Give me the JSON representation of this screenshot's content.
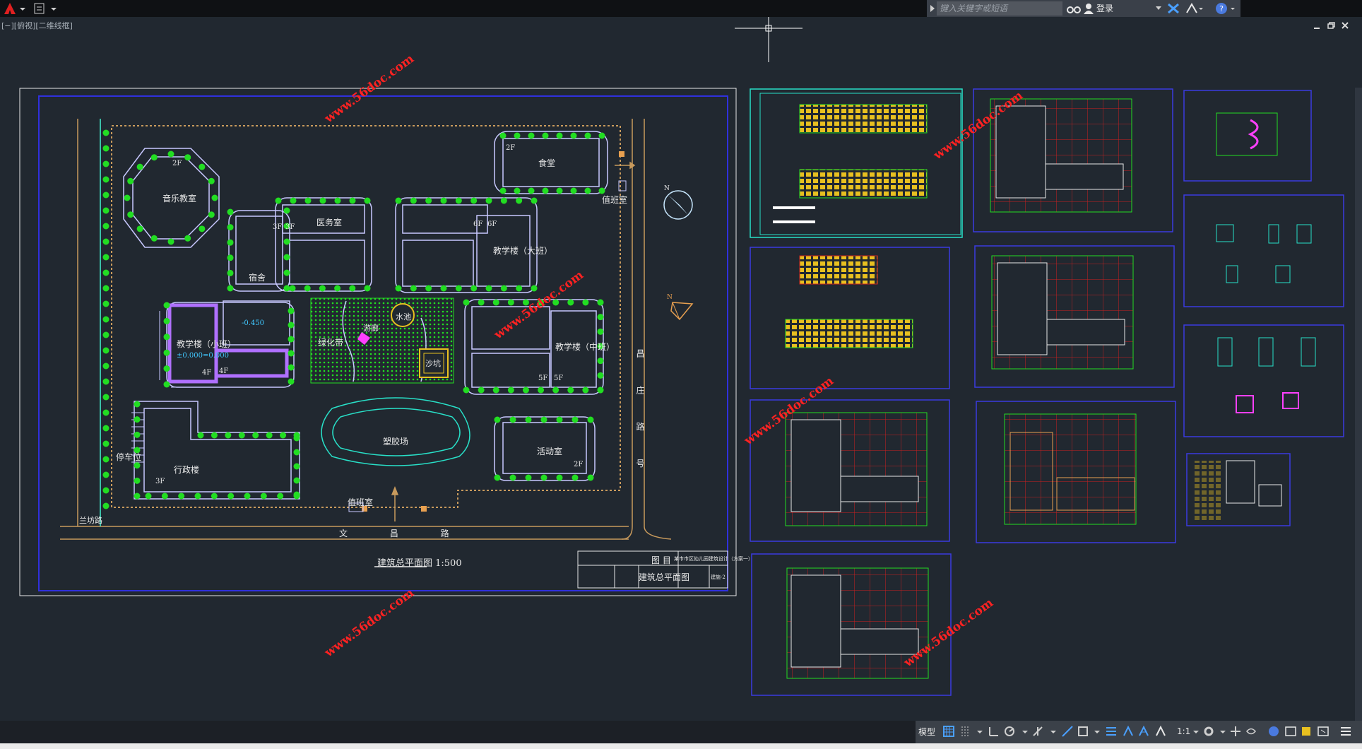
{
  "titlebar": {
    "search_placeholder": "键入关键字或短语",
    "login": "登录"
  },
  "viewport_label": "[−][俯视][二维线框]",
  "site_plan": {
    "buildings": {
      "music": "音乐教室",
      "music_floors": "2F",
      "dormitory": "宿舍",
      "dorm_floors": "3F",
      "clinic": "医务室",
      "clinic_floors": "3F",
      "canteen": "食堂",
      "canteen_floors": "2F",
      "teach_large": "教学楼（大班）",
      "teach_large_floors_a": "6F",
      "teach_large_floors_b": "6F",
      "teach_small": "教学楼（小班）",
      "teach_small_floors_a": "4F",
      "teach_small_floors_b": "4F",
      "teach_mid": "教学楼（中班）",
      "teach_mid_floors_a": "5F",
      "teach_mid_floors_b": "5F",
      "admin": "行政楼",
      "admin_floors": "3F",
      "gym": "活动室",
      "gym_floors": "2F"
    },
    "landscape": {
      "garden": "绿化带",
      "corridor": "游廊",
      "pond": "水池",
      "sandpit": "沙坑",
      "track": "塑胶场"
    },
    "elevations": {
      "level_a": "-0.450",
      "level_b": "±0.000=0.000"
    },
    "labels": {
      "guard_top": "值班室",
      "guard_bottom": "值班室",
      "parking": "停车位",
      "north": "N",
      "north_small": "N",
      "road_bottom": "文 昌 路",
      "road_right": "昌 庄 路 号",
      "road_left": "兰坊路"
    },
    "plan_title": "建筑总平面图 1:500",
    "titleblock": {
      "header": "图 目",
      "project": "某市市区幼儿园建筑设计（方案一）",
      "drawing_name": "建筑总平面图",
      "sheet_no": "建施-2"
    }
  },
  "watermark": "www.56doc.com",
  "statusbar": {
    "model": "模型",
    "scale": "1:1"
  },
  "colors": {
    "background": "#212830",
    "site_outline": "#c89a5c",
    "building_outline": "#c8c8ff",
    "trees": "#22dd22",
    "watermark": "#ff2222",
    "sheet_border": "#3a3ae0"
  }
}
